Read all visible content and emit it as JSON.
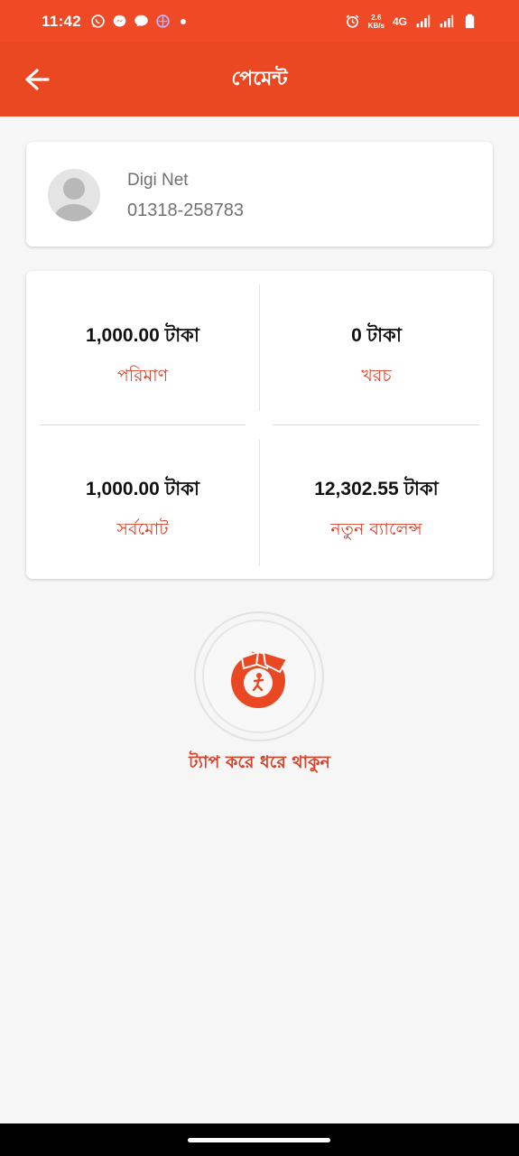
{
  "status_bar": {
    "time": "11:42",
    "speed_value": "2.6",
    "speed_unit": "KB/s",
    "network": "4G",
    "icons": [
      "whatsapp-icon",
      "messenger-icon",
      "chat-icon",
      "app-icon",
      "alarm-icon",
      "signal-icon",
      "signal-icon",
      "battery-icon"
    ]
  },
  "app_bar": {
    "title": "পেমেন্ট",
    "back_icon": "arrow-left-icon"
  },
  "recipient": {
    "name": "Digi Net",
    "phone": "01318-258783"
  },
  "summary": {
    "amount": {
      "value": "1,000.00 টাকা",
      "label": "পরিমাণ"
    },
    "charge": {
      "value": "0 টাকা",
      "label": "খরচ"
    },
    "total": {
      "value": "1,000.00 টাকা",
      "label": "সর্বমোট"
    },
    "new_balance": {
      "value": "12,302.55 টাকা",
      "label": "নতুন ব্যালেন্স"
    }
  },
  "tap_action": {
    "label": "ট্যাপ করে ধরে থাকুন",
    "icon": "bkash-logo-icon"
  },
  "colors": {
    "primary": "#e94822",
    "status_bar": "#ee4a25",
    "label_red": "#d8432a",
    "background": "#f6f6f6"
  }
}
